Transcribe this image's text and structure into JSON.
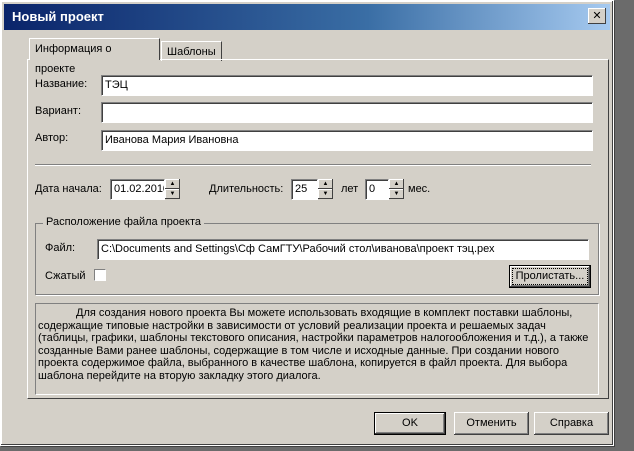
{
  "window": {
    "title": "Новый проект",
    "close_glyph": "✕"
  },
  "tabs": [
    {
      "label": "Информация о проекте",
      "active": true
    },
    {
      "label": "Шаблоны",
      "active": false
    }
  ],
  "form": {
    "name_label": "Название:",
    "name_value": "ТЭЦ",
    "variant_label": "Вариант:",
    "variant_value": "",
    "author_label": "Автор:",
    "author_value": "Иванова Мария Ивановна",
    "start_date_label": "Дата начала:",
    "start_date_value": "01.02.2010",
    "duration_label": "Длительность:",
    "duration_years_value": "25",
    "years_unit": "лет",
    "duration_months_value": "0",
    "months_unit": "мес."
  },
  "file_group": {
    "title": "Расположение файла проекта",
    "file_label": "Файл:",
    "file_value": "C:\\Documents and Settings\\Сф СамГТУ\\Рабочий стол\\иванова\\проект тэц.рех",
    "compressed_label": "Сжатый",
    "compressed_checked": false,
    "browse_button": "Пролистать..."
  },
  "info_text": "Для создания нового проекта Вы можете использовать входящие в комплект поставки шаблоны, содержащие типовые настройки в зависимости от условий реализации проекта и решаемых задач (таблицы, графики, шаблоны текстового описания, настройки параметров налогообложения и т.д.), а также созданные Вами ранее шаблоны, содержащие в том числе и исходные данные. При создании нового проекта содержимое файла, выбранного в качестве шаблона, копируется в файл проекта. Для выбора шаблона перейдите на вторую закладку этого диалога.",
  "buttons": {
    "ok": "OK",
    "cancel": "Отменить",
    "help": "Справка"
  },
  "spin_glyphs": {
    "up": "▲",
    "down": "▼"
  }
}
